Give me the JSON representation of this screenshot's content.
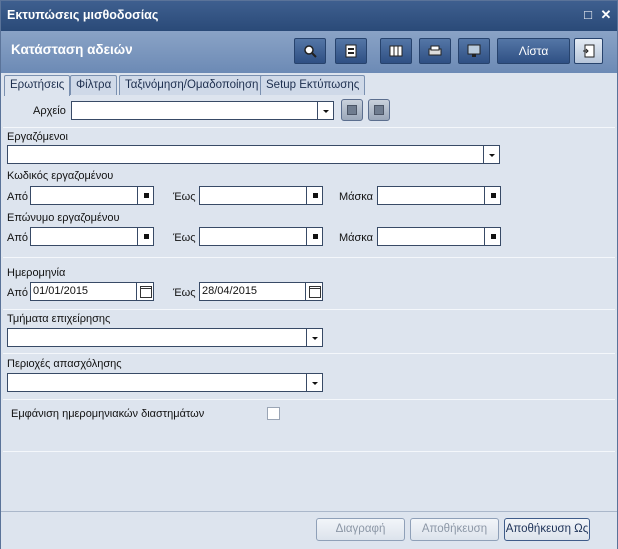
{
  "window": {
    "title": "Εκτυπώσεις μισθοδοσίας",
    "subtitle": "Κατάσταση αδειών",
    "restore_glyph": "□",
    "close_glyph": "✕"
  },
  "toolbar": {
    "buttons": [
      {
        "icon": "magnifier-icon"
      },
      {
        "icon": "report-icon"
      },
      {
        "icon": "columns-icon"
      },
      {
        "icon": "printer-icon"
      },
      {
        "icon": "monitor-icon"
      }
    ],
    "list_label": "Λίστα",
    "export_icon": "document-export-icon"
  },
  "tabs": [
    {
      "label": "Ερωτήσεις",
      "active": true
    },
    {
      "label": "Φίλτρα",
      "active": false
    },
    {
      "label": "Ταξινόμηση/Ομαδοποίηση",
      "active": false
    },
    {
      "label": "Setup Εκτύπωσης",
      "active": false
    }
  ],
  "file": {
    "label": "Αρχείο",
    "value": ""
  },
  "employees": {
    "label": "Εργαζόμενοι",
    "value": ""
  },
  "employee_code": {
    "label": "Κωδικός εργαζομένου",
    "from_label": "Από",
    "to_label": "Έως",
    "mask_label": "Μάσκα",
    "from": "",
    "to": "",
    "mask": ""
  },
  "employee_surname": {
    "label": "Επώνυμο εργαζομένου",
    "from_label": "Από",
    "to_label": "Έως",
    "mask_label": "Μάσκα",
    "from": "",
    "to": "",
    "mask": ""
  },
  "date": {
    "label": "Ημερομηνία",
    "from_label": "Από",
    "to_label": "Έως",
    "from": "01/01/2015",
    "to": "28/04/2015"
  },
  "departments": {
    "label": "Τμήματα επιχείρησης",
    "value": ""
  },
  "work_areas": {
    "label": "Περιοχές απασχόλησης",
    "value": ""
  },
  "show_intervals": {
    "label": "Εμφάνιση ημερομηνιακών διαστημάτων",
    "checked": false
  },
  "footer": {
    "delete": "Διαγραφή",
    "save": "Αποθήκευση",
    "save_as": "Αποθήκευση Ως"
  },
  "colors": {
    "title_bg": "#2f4f7f",
    "header_bg": "#7b96bd",
    "panel_bg": "#dde4ee"
  }
}
